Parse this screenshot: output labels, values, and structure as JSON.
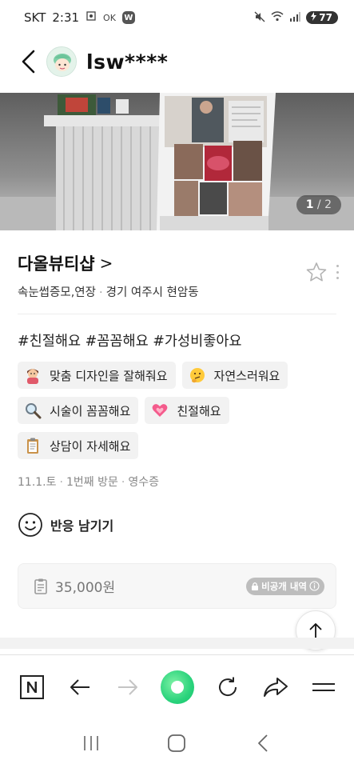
{
  "status_bar": {
    "carrier": "SKT",
    "time": "2:31",
    "ok_label": "OK",
    "w_label": "W",
    "battery": "77"
  },
  "header": {
    "username": "lsw****"
  },
  "photo": {
    "current_page": "1",
    "total_pages": "/ 2"
  },
  "place": {
    "name": "다올뷰티샵",
    "chevron": ">",
    "category": "속눈썹증모,연장",
    "separator": "·",
    "location": "경기 여주시 현암동"
  },
  "review": {
    "hashtags": "#친절해요 #꼼꼼해요 #가성비좋아요",
    "keywords": [
      {
        "label": "맞춤 디자인을 잘해줘요",
        "icon": "woman-haircut-emoji"
      },
      {
        "label": "자연스러워요",
        "icon": "thinking-face-emoji"
      },
      {
        "label": "시술이 꼼꼼해요",
        "icon": "magnifier-emoji"
      },
      {
        "label": "친절해요",
        "icon": "pink-heart-emoji"
      },
      {
        "label": "상담이 자세해요",
        "icon": "clipboard-emoji"
      }
    ],
    "visit_date": "11.1.토",
    "visit_count": "1번째 방문",
    "proof": "영수증",
    "visit_sep": "·",
    "reaction_label": "반응 남기기",
    "receipt_amount": "35,000원",
    "private_label": "비공개 내역"
  },
  "colors": {
    "green_button": "#2bd37c",
    "chip_bg": "#f2f2f2",
    "private_badge": "#bdbdbd"
  }
}
